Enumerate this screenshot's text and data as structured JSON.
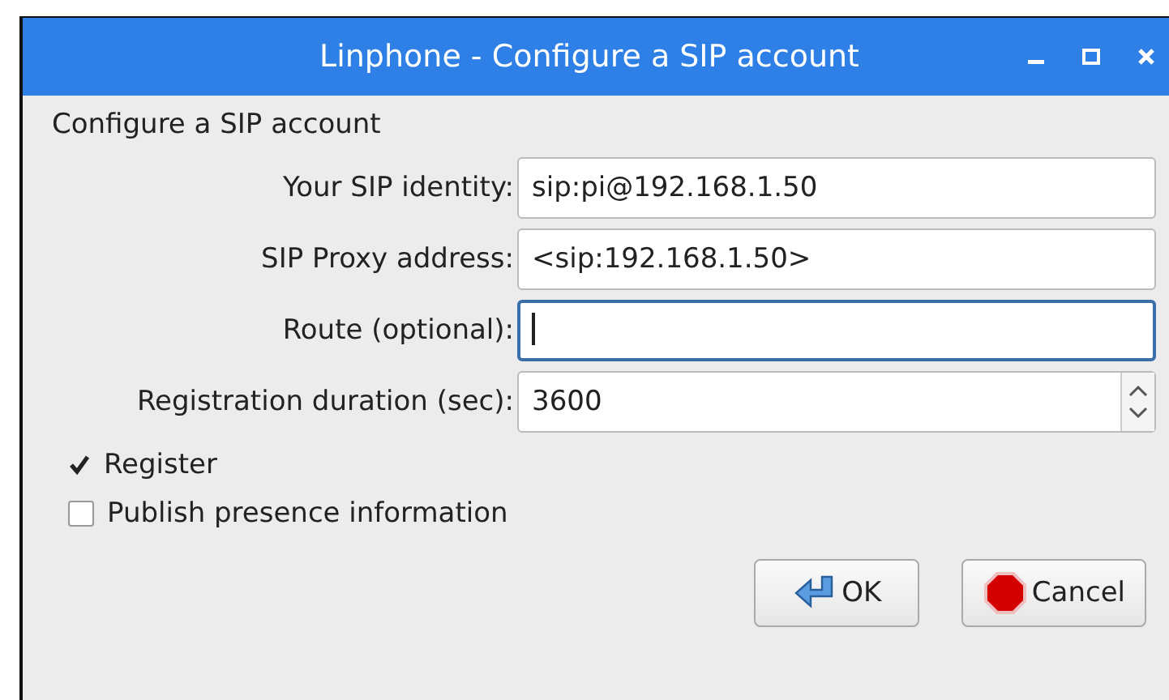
{
  "window": {
    "title": "Linphone - Configure a SIP account"
  },
  "heading": "Configure a SIP account",
  "fields": [
    {
      "label": "Your SIP identity:",
      "value": "sip:pi@192.168.1.50",
      "kind": "text",
      "focused": false
    },
    {
      "label": "SIP Proxy address:",
      "value": "<sip:192.168.1.50>",
      "kind": "text",
      "focused": false
    },
    {
      "label": "Route (optional):",
      "kind": "text",
      "focused": true
    },
    {
      "label": "Registration duration (sec):",
      "value": "3600",
      "kind": "spin",
      "focused": false
    }
  ],
  "checkboxes": [
    {
      "label": "Register",
      "checked": true
    },
    {
      "label": "Publish presence information",
      "checked": false
    }
  ],
  "buttons": [
    {
      "label": "OK",
      "kind": "ok"
    },
    {
      "label": "Cancel",
      "kind": "cancel"
    }
  ]
}
